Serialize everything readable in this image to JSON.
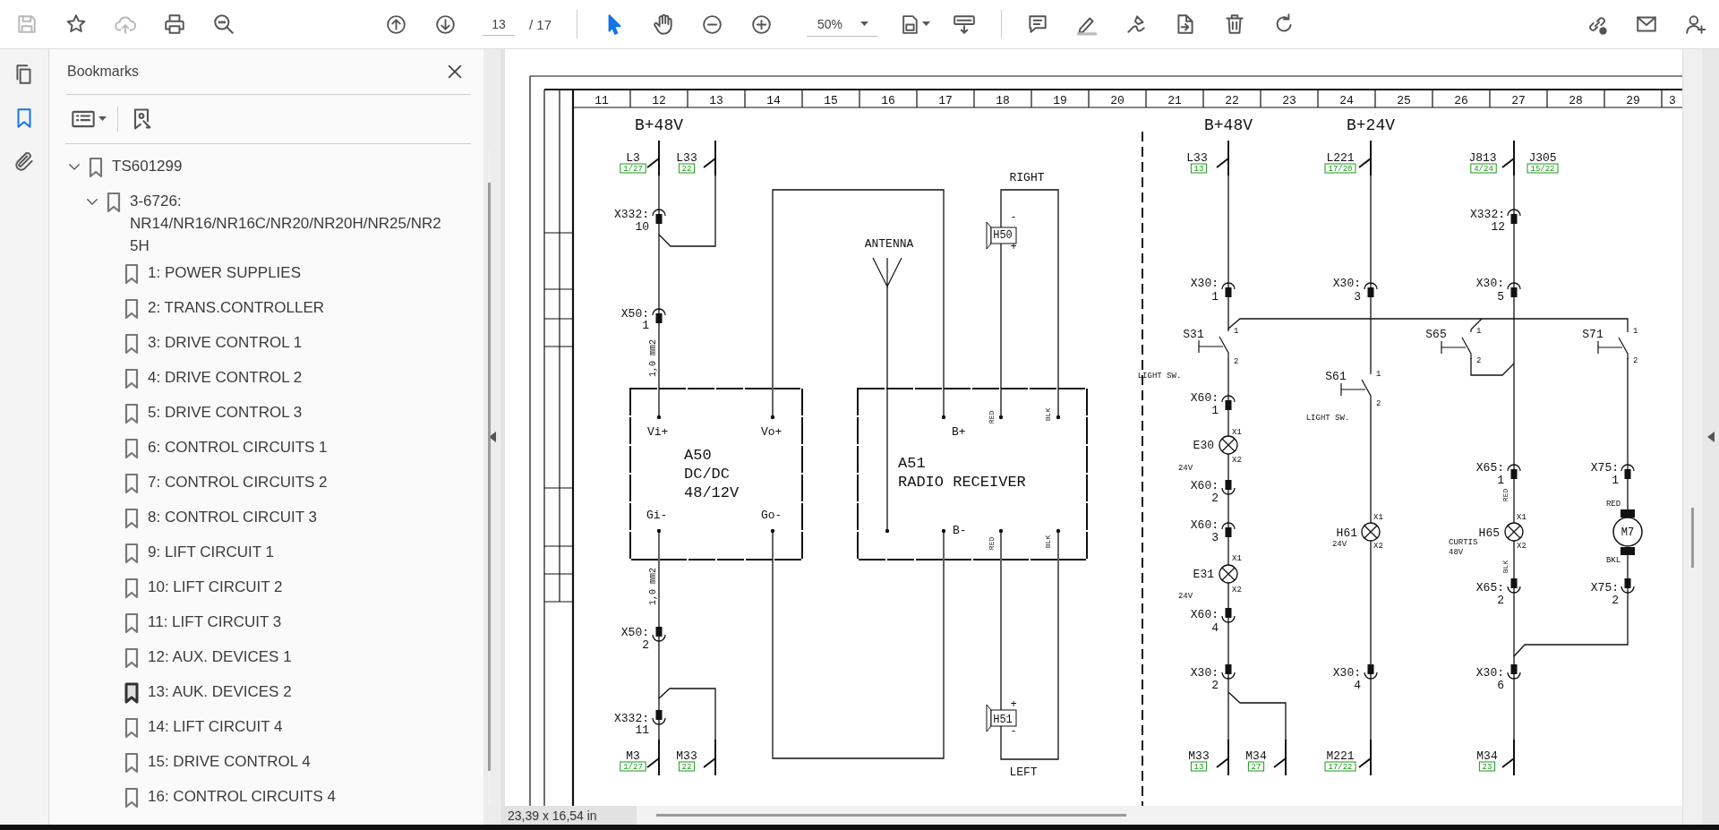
{
  "toolbar": {
    "file_actions": [
      {
        "kind": "save",
        "disabled": true
      },
      {
        "kind": "star",
        "disabled": false
      },
      {
        "kind": "upload",
        "disabled": true
      },
      {
        "kind": "print",
        "disabled": false
      },
      {
        "kind": "find",
        "disabled": false
      }
    ],
    "page_number": "13",
    "page_count": "/ 17",
    "tools": [
      {
        "kind": "select",
        "selected": true
      },
      {
        "kind": "hand",
        "selected": false
      }
    ],
    "zoom": "50%"
  },
  "nav": {
    "panels": [
      {
        "kind": "pages",
        "selected": false
      },
      {
        "kind": "bookmarks",
        "selected": true
      },
      {
        "kind": "attachments",
        "selected": false
      }
    ]
  },
  "bookmarks": {
    "title": "Bookmarks",
    "tree": [
      {
        "label": "TS601299",
        "selected": false,
        "expanded": true,
        "children": [
          {
            "label": "3-6726: NR14/NR16/NR16C/NR20/NR20H/NR25/NR25H",
            "selected": false,
            "expanded": true,
            "children": [
              {
                "label": "1: POWER SUPPLIES",
                "selected": false
              },
              {
                "label": "2: TRANS.CONTROLLER",
                "selected": false
              },
              {
                "label": "3: DRIVE CONTROL 1",
                "selected": false
              },
              {
                "label": "4: DRIVE CONTROL 2",
                "selected": false
              },
              {
                "label": "5: DRIVE CONTROL 3",
                "selected": false
              },
              {
                "label": "6: CONTROL CIRCUITS 1",
                "selected": false
              },
              {
                "label": "7: CONTROL CIRCUITS 2",
                "selected": false
              },
              {
                "label": "8: CONTROL CIRCUIT 3",
                "selected": false
              },
              {
                "label": "9: LIFT CIRCUIT 1",
                "selected": false
              },
              {
                "label": "10: LIFT CIRCUIT 2",
                "selected": false
              },
              {
                "label": "11: LIFT CIRCUIT 3",
                "selected": false
              },
              {
                "label": "12: AUX. DEVICES 1",
                "selected": false
              },
              {
                "label": "13: AUK. DEVICES 2",
                "selected": true
              },
              {
                "label": "14: LIFT CIRCUIT 4",
                "selected": false
              },
              {
                "label": "15: DRIVE CONTROL 4",
                "selected": false
              },
              {
                "label": "16: CONTROL CIRCUITS 4",
                "selected": false
              }
            ]
          }
        ]
      }
    ]
  },
  "page": {
    "column_numbers": [
      "11",
      "12",
      "13",
      "14",
      "15",
      "16",
      "17",
      "18",
      "19",
      "20",
      "21",
      "22",
      "23",
      "24",
      "25",
      "26",
      "27",
      "28",
      "29",
      "3"
    ],
    "texts": [
      {
        "text": "B+48V",
        "kind": "label"
      },
      {
        "text": "L3",
        "kind": "label"
      },
      {
        "text": "1/27",
        "kind": "ref"
      },
      {
        "text": "L33",
        "kind": "label"
      },
      {
        "text": "22",
        "kind": "ref"
      },
      {
        "text": "X332:",
        "kind": "label"
      },
      {
        "text": "10",
        "kind": "label"
      },
      {
        "text": "X50:",
        "kind": "label"
      },
      {
        "text": "1",
        "kind": "label"
      },
      {
        "text": "1,0 mm2",
        "kind": "vertical"
      },
      {
        "text": "Vi+",
        "kind": "label"
      },
      {
        "text": "Vo+",
        "kind": "label"
      },
      {
        "text": "A50",
        "kind": "label"
      },
      {
        "text": "DC/DC",
        "kind": "label"
      },
      {
        "text": "48/12V",
        "kind": "label"
      },
      {
        "text": "Gi-",
        "kind": "label"
      },
      {
        "text": "Go-",
        "kind": "label"
      },
      {
        "text": "1,0 mm2",
        "kind": "vertical"
      },
      {
        "text": "X50:",
        "kind": "label"
      },
      {
        "text": "2",
        "kind": "label"
      },
      {
        "text": "X332:",
        "kind": "label"
      },
      {
        "text": "11",
        "kind": "label"
      },
      {
        "text": "M3",
        "kind": "label"
      },
      {
        "text": "1/27",
        "kind": "ref"
      },
      {
        "text": "M33",
        "kind": "label"
      },
      {
        "text": "22",
        "kind": "ref"
      },
      {
        "text": "ANTENNA",
        "kind": "label"
      },
      {
        "text": "RIGHT",
        "kind": "label"
      },
      {
        "text": "-",
        "kind": "label"
      },
      {
        "text": "H50",
        "kind": "label"
      },
      {
        "text": "+",
        "kind": "label"
      },
      {
        "text": "B+",
        "kind": "label"
      },
      {
        "text": "RED",
        "kind": "vertical"
      },
      {
        "text": "BLK",
        "kind": "vertical"
      },
      {
        "text": "A51",
        "kind": "label"
      },
      {
        "text": "RADIO RECEIVER",
        "kind": "label"
      },
      {
        "text": "B-",
        "kind": "label"
      },
      {
        "text": "RED",
        "kind": "vertical"
      },
      {
        "text": "BLK",
        "kind": "vertical"
      },
      {
        "text": "+",
        "kind": "label"
      },
      {
        "text": "H51",
        "kind": "label"
      },
      {
        "text": "-",
        "kind": "label"
      },
      {
        "text": "LEFT",
        "kind": "label"
      },
      {
        "text": "B+48V",
        "kind": "label"
      },
      {
        "text": "B+24V",
        "kind": "label"
      },
      {
        "text": "L33",
        "kind": "label"
      },
      {
        "text": "13",
        "kind": "ref"
      },
      {
        "text": "L221",
        "kind": "label"
      },
      {
        "text": "17/20",
        "kind": "ref"
      },
      {
        "text": "J813",
        "kind": "label"
      },
      {
        "text": "4/24",
        "kind": "ref"
      },
      {
        "text": "J305",
        "kind": "label"
      },
      {
        "text": "15/22",
        "kind": "ref"
      },
      {
        "text": "X332:",
        "kind": "label"
      },
      {
        "text": "12",
        "kind": "label"
      },
      {
        "text": "X30:",
        "kind": "label"
      },
      {
        "text": "1",
        "kind": "label"
      },
      {
        "text": "X30:",
        "kind": "label"
      },
      {
        "text": "3",
        "kind": "label"
      },
      {
        "text": "X30:",
        "kind": "label"
      },
      {
        "text": "5",
        "kind": "label"
      },
      {
        "text": "S31",
        "kind": "label"
      },
      {
        "text": "1",
        "kind": "label"
      },
      {
        "text": "2",
        "kind": "label"
      },
      {
        "text": "S65",
        "kind": "label"
      },
      {
        "text": "1",
        "kind": "label"
      },
      {
        "text": "2",
        "kind": "label"
      },
      {
        "text": "S71",
        "kind": "label"
      },
      {
        "text": "1",
        "kind": "label"
      },
      {
        "text": "2",
        "kind": "label"
      },
      {
        "text": "LIGHT SW.",
        "kind": "label"
      },
      {
        "text": "S61",
        "kind": "label"
      },
      {
        "text": "1",
        "kind": "label"
      },
      {
        "text": "2",
        "kind": "label"
      },
      {
        "text": "X60:",
        "kind": "label"
      },
      {
        "text": "1",
        "kind": "label"
      },
      {
        "text": "LIGHT SW.",
        "kind": "label"
      },
      {
        "text": "X1",
        "kind": "label"
      },
      {
        "text": "E30",
        "kind": "label"
      },
      {
        "text": "X2",
        "kind": "label"
      },
      {
        "text": "24V",
        "kind": "label"
      },
      {
        "text": "X60:",
        "kind": "label"
      },
      {
        "text": "2",
        "kind": "label"
      },
      {
        "text": "X65:",
        "kind": "label"
      },
      {
        "text": "1",
        "kind": "label"
      },
      {
        "text": "X75:",
        "kind": "label"
      },
      {
        "text": "1",
        "kind": "label"
      },
      {
        "text": "RED",
        "kind": "vertical"
      },
      {
        "text": "RED",
        "kind": "label"
      },
      {
        "text": "X1",
        "kind": "label"
      },
      {
        "text": "H61",
        "kind": "label"
      },
      {
        "text": "24V",
        "kind": "label"
      },
      {
        "text": "X2",
        "kind": "label"
      },
      {
        "text": "X1",
        "kind": "label"
      },
      {
        "text": "H65",
        "kind": "label"
      },
      {
        "text": "CURTIS",
        "kind": "label"
      },
      {
        "text": "48V",
        "kind": "label"
      },
      {
        "text": "X2",
        "kind": "label"
      },
      {
        "text": "M7",
        "kind": "label"
      },
      {
        "text": "X60:",
        "kind": "label"
      },
      {
        "text": "3",
        "kind": "label"
      },
      {
        "text": "X1",
        "kind": "label"
      },
      {
        "text": "E31",
        "kind": "label"
      },
      {
        "text": "X2",
        "kind": "label"
      },
      {
        "text": "24V",
        "kind": "label"
      },
      {
        "text": "BLK",
        "kind": "vertical"
      },
      {
        "text": "BKL",
        "kind": "label"
      },
      {
        "text": "X65:",
        "kind": "label"
      },
      {
        "text": "2",
        "kind": "label"
      },
      {
        "text": "X75:",
        "kind": "label"
      },
      {
        "text": "2",
        "kind": "label"
      },
      {
        "text": "X60:",
        "kind": "label"
      },
      {
        "text": "4",
        "kind": "label"
      },
      {
        "text": "X30:",
        "kind": "label"
      },
      {
        "text": "2",
        "kind": "label"
      },
      {
        "text": "X30:",
        "kind": "label"
      },
      {
        "text": "4",
        "kind": "label"
      },
      {
        "text": "X30:",
        "kind": "label"
      },
      {
        "text": "6",
        "kind": "label"
      },
      {
        "text": "M33",
        "kind": "label"
      },
      {
        "text": "13",
        "kind": "ref"
      },
      {
        "text": "M34",
        "kind": "label"
      },
      {
        "text": "27",
        "kind": "ref"
      },
      {
        "text": "M221",
        "kind": "label"
      },
      {
        "text": "17/22",
        "kind": "ref"
      },
      {
        "text": "M34",
        "kind": "label"
      },
      {
        "text": "23",
        "kind": "ref"
      }
    ]
  },
  "status_bar": {
    "page_size": "23,39 x 16,54 in"
  }
}
